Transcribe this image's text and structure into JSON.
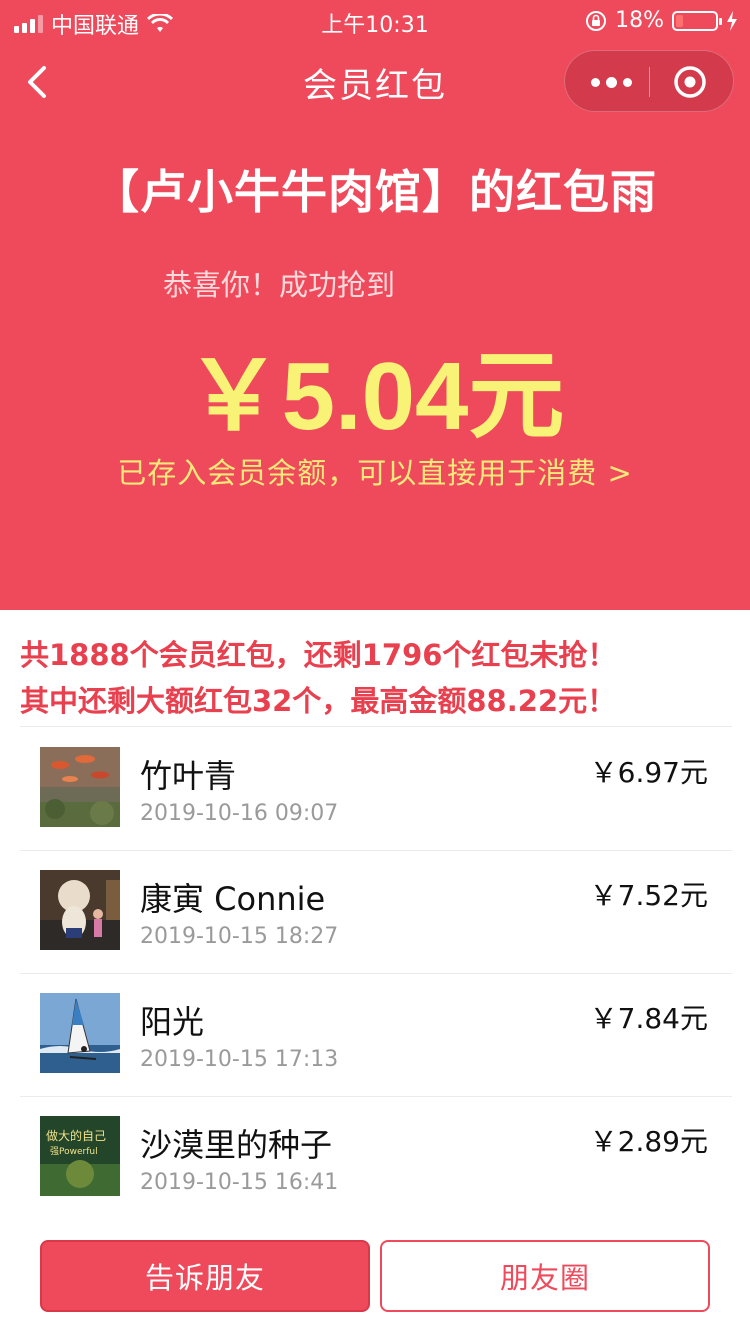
{
  "status_bar": {
    "carrier": "中国联通",
    "time": "上午10:31",
    "battery": "18%",
    "battery_level": 0.18
  },
  "navbar": {
    "title": "会员红包",
    "back_icon": "chevron-left-icon",
    "more_icon": "more-dots-icon",
    "close_icon": "target-circle-icon"
  },
  "hero": {
    "shop_title": "【卢小牛牛肉馆】的红包雨",
    "congrats": "恭喜你！成功抢到",
    "amount": "￥5.04",
    "amount_unit": "元",
    "saved_link": "已存入会员余额，可以直接用于消费 >"
  },
  "summary": {
    "line1": "共1888个会员红包，还剩1796个红包未抢！",
    "line2": "其中还剩大额红包32个，最高金额88.22元！"
  },
  "records": [
    {
      "name": "竹叶青",
      "time": "2019-10-16 09:07",
      "amount": "￥6.97元",
      "avatar": "koi-fish-avatar"
    },
    {
      "name": "康寅 Connie",
      "time": "2019-10-15 18:27",
      "amount": "￥7.52元",
      "avatar": "mascot-photo-avatar"
    },
    {
      "name": "阳光",
      "time": "2019-10-15 17:13",
      "amount": "￥7.84元",
      "avatar": "windsurf-avatar"
    },
    {
      "name": "沙漠里的种子",
      "time": "2019-10-15 16:41",
      "amount": "￥2.89元",
      "avatar": "green-poster-avatar",
      "avatar_text": "做大的自己 强Powerful"
    }
  ],
  "buttons": {
    "tell_friends": "告诉朋友",
    "moments": "朋友圈"
  },
  "colors": {
    "brand_red": "#ee4a5b",
    "amount_yellow": "#f8f277",
    "summary_red": "#e8404f"
  }
}
